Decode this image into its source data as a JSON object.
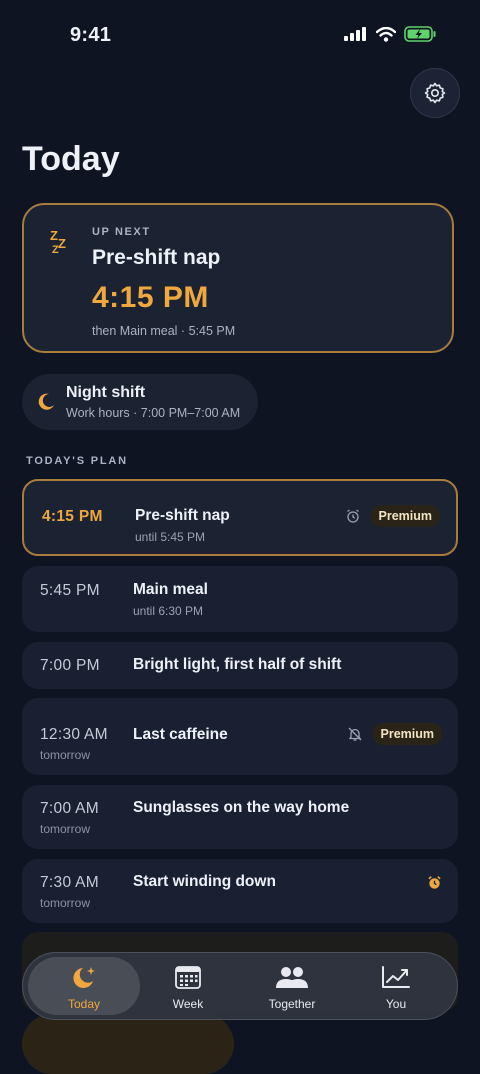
{
  "status_bar": {
    "time": "9:41"
  },
  "page": {
    "title": "Today"
  },
  "up_next": {
    "eyebrow": "UP NEXT",
    "title": "Pre-shift nap",
    "time": "4:15 PM",
    "then": "then Main meal · 5:45 PM",
    "icon": "zzz-icon"
  },
  "shift": {
    "title": "Night shift",
    "hours": "Work hours · 7:00 PM–7:00 AM",
    "icon": "moon-icon"
  },
  "plan": {
    "label": "TODAY'S PLAN",
    "items": [
      {
        "time": "4:15 PM",
        "title": "Pre-shift nap",
        "sub": "until 5:45 PM",
        "badge": "Premium",
        "icon": "alarm-outline-icon"
      },
      {
        "time": "5:45 PM",
        "title": "Main meal",
        "sub": "until 6:30 PM"
      },
      {
        "time": "7:00 PM",
        "title": "Bright light, first half of shift"
      },
      {
        "time": "12:30 AM",
        "day": "tomorrow",
        "title": "Last caffeine",
        "badge": "Premium",
        "icon": "bell-off-icon"
      },
      {
        "time": "7:00 AM",
        "day": "tomorrow",
        "title": "Sunglasses on the way home"
      },
      {
        "time": "7:30 AM",
        "day": "tomorrow",
        "title": "Start winding down",
        "icon": "alarm-filled-icon"
      }
    ]
  },
  "tabs": [
    {
      "label": "Today",
      "icon": "moon-stars-icon",
      "active": true
    },
    {
      "label": "Week",
      "icon": "calendar-icon"
    },
    {
      "label": "Together",
      "icon": "people-icon"
    },
    {
      "label": "You",
      "icon": "trend-chart-icon"
    }
  ],
  "colors": {
    "accent": "#f0a83e",
    "background": "#0e1422",
    "card": "#192031",
    "border_accent": "#a77c3c"
  }
}
